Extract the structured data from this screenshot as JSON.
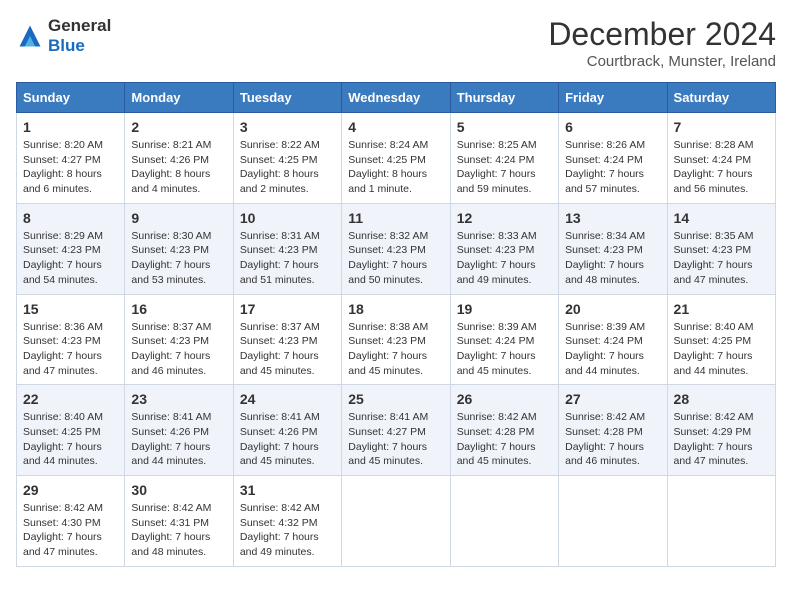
{
  "logo": {
    "text_general": "General",
    "text_blue": "Blue"
  },
  "header": {
    "month_year": "December 2024",
    "location": "Courtbrack, Munster, Ireland"
  },
  "weekdays": [
    "Sunday",
    "Monday",
    "Tuesday",
    "Wednesday",
    "Thursday",
    "Friday",
    "Saturday"
  ],
  "weeks": [
    [
      {
        "day": "1",
        "sunrise": "Sunrise: 8:20 AM",
        "sunset": "Sunset: 4:27 PM",
        "daylight": "Daylight: 8 hours and 6 minutes."
      },
      {
        "day": "2",
        "sunrise": "Sunrise: 8:21 AM",
        "sunset": "Sunset: 4:26 PM",
        "daylight": "Daylight: 8 hours and 4 minutes."
      },
      {
        "day": "3",
        "sunrise": "Sunrise: 8:22 AM",
        "sunset": "Sunset: 4:25 PM",
        "daylight": "Daylight: 8 hours and 2 minutes."
      },
      {
        "day": "4",
        "sunrise": "Sunrise: 8:24 AM",
        "sunset": "Sunset: 4:25 PM",
        "daylight": "Daylight: 8 hours and 1 minute."
      },
      {
        "day": "5",
        "sunrise": "Sunrise: 8:25 AM",
        "sunset": "Sunset: 4:24 PM",
        "daylight": "Daylight: 7 hours and 59 minutes."
      },
      {
        "day": "6",
        "sunrise": "Sunrise: 8:26 AM",
        "sunset": "Sunset: 4:24 PM",
        "daylight": "Daylight: 7 hours and 57 minutes."
      },
      {
        "day": "7",
        "sunrise": "Sunrise: 8:28 AM",
        "sunset": "Sunset: 4:24 PM",
        "daylight": "Daylight: 7 hours and 56 minutes."
      }
    ],
    [
      {
        "day": "8",
        "sunrise": "Sunrise: 8:29 AM",
        "sunset": "Sunset: 4:23 PM",
        "daylight": "Daylight: 7 hours and 54 minutes."
      },
      {
        "day": "9",
        "sunrise": "Sunrise: 8:30 AM",
        "sunset": "Sunset: 4:23 PM",
        "daylight": "Daylight: 7 hours and 53 minutes."
      },
      {
        "day": "10",
        "sunrise": "Sunrise: 8:31 AM",
        "sunset": "Sunset: 4:23 PM",
        "daylight": "Daylight: 7 hours and 51 minutes."
      },
      {
        "day": "11",
        "sunrise": "Sunrise: 8:32 AM",
        "sunset": "Sunset: 4:23 PM",
        "daylight": "Daylight: 7 hours and 50 minutes."
      },
      {
        "day": "12",
        "sunrise": "Sunrise: 8:33 AM",
        "sunset": "Sunset: 4:23 PM",
        "daylight": "Daylight: 7 hours and 49 minutes."
      },
      {
        "day": "13",
        "sunrise": "Sunrise: 8:34 AM",
        "sunset": "Sunset: 4:23 PM",
        "daylight": "Daylight: 7 hours and 48 minutes."
      },
      {
        "day": "14",
        "sunrise": "Sunrise: 8:35 AM",
        "sunset": "Sunset: 4:23 PM",
        "daylight": "Daylight: 7 hours and 47 minutes."
      }
    ],
    [
      {
        "day": "15",
        "sunrise": "Sunrise: 8:36 AM",
        "sunset": "Sunset: 4:23 PM",
        "daylight": "Daylight: 7 hours and 47 minutes."
      },
      {
        "day": "16",
        "sunrise": "Sunrise: 8:37 AM",
        "sunset": "Sunset: 4:23 PM",
        "daylight": "Daylight: 7 hours and 46 minutes."
      },
      {
        "day": "17",
        "sunrise": "Sunrise: 8:37 AM",
        "sunset": "Sunset: 4:23 PM",
        "daylight": "Daylight: 7 hours and 45 minutes."
      },
      {
        "day": "18",
        "sunrise": "Sunrise: 8:38 AM",
        "sunset": "Sunset: 4:23 PM",
        "daylight": "Daylight: 7 hours and 45 minutes."
      },
      {
        "day": "19",
        "sunrise": "Sunrise: 8:39 AM",
        "sunset": "Sunset: 4:24 PM",
        "daylight": "Daylight: 7 hours and 45 minutes."
      },
      {
        "day": "20",
        "sunrise": "Sunrise: 8:39 AM",
        "sunset": "Sunset: 4:24 PM",
        "daylight": "Daylight: 7 hours and 44 minutes."
      },
      {
        "day": "21",
        "sunrise": "Sunrise: 8:40 AM",
        "sunset": "Sunset: 4:25 PM",
        "daylight": "Daylight: 7 hours and 44 minutes."
      }
    ],
    [
      {
        "day": "22",
        "sunrise": "Sunrise: 8:40 AM",
        "sunset": "Sunset: 4:25 PM",
        "daylight": "Daylight: 7 hours and 44 minutes."
      },
      {
        "day": "23",
        "sunrise": "Sunrise: 8:41 AM",
        "sunset": "Sunset: 4:26 PM",
        "daylight": "Daylight: 7 hours and 44 minutes."
      },
      {
        "day": "24",
        "sunrise": "Sunrise: 8:41 AM",
        "sunset": "Sunset: 4:26 PM",
        "daylight": "Daylight: 7 hours and 45 minutes."
      },
      {
        "day": "25",
        "sunrise": "Sunrise: 8:41 AM",
        "sunset": "Sunset: 4:27 PM",
        "daylight": "Daylight: 7 hours and 45 minutes."
      },
      {
        "day": "26",
        "sunrise": "Sunrise: 8:42 AM",
        "sunset": "Sunset: 4:28 PM",
        "daylight": "Daylight: 7 hours and 45 minutes."
      },
      {
        "day": "27",
        "sunrise": "Sunrise: 8:42 AM",
        "sunset": "Sunset: 4:28 PM",
        "daylight": "Daylight: 7 hours and 46 minutes."
      },
      {
        "day": "28",
        "sunrise": "Sunrise: 8:42 AM",
        "sunset": "Sunset: 4:29 PM",
        "daylight": "Daylight: 7 hours and 47 minutes."
      }
    ],
    [
      {
        "day": "29",
        "sunrise": "Sunrise: 8:42 AM",
        "sunset": "Sunset: 4:30 PM",
        "daylight": "Daylight: 7 hours and 47 minutes."
      },
      {
        "day": "30",
        "sunrise": "Sunrise: 8:42 AM",
        "sunset": "Sunset: 4:31 PM",
        "daylight": "Daylight: 7 hours and 48 minutes."
      },
      {
        "day": "31",
        "sunrise": "Sunrise: 8:42 AM",
        "sunset": "Sunset: 4:32 PM",
        "daylight": "Daylight: 7 hours and 49 minutes."
      },
      null,
      null,
      null,
      null
    ]
  ]
}
